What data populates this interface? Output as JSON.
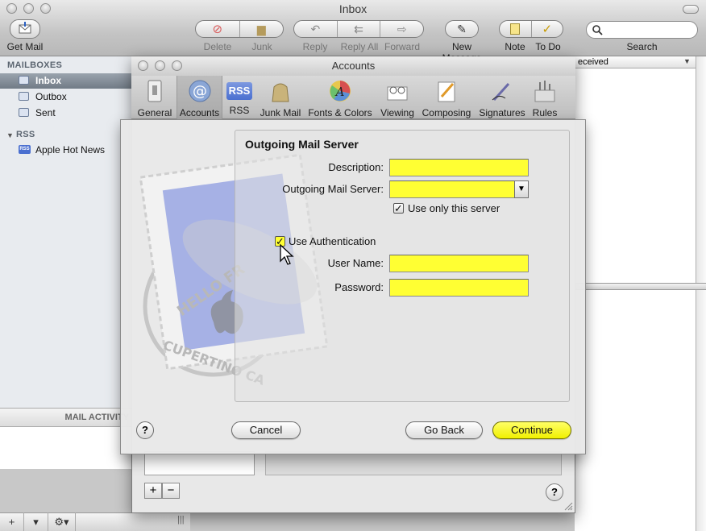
{
  "mail_window": {
    "title": "Inbox",
    "toolbar": {
      "get_mail": "Get Mail",
      "delete": "Delete",
      "junk": "Junk",
      "reply": "Reply",
      "reply_all": "Reply All",
      "forward": "Forward",
      "new_message": "New Message",
      "note": "Note",
      "todo": "To Do",
      "search": "Search"
    },
    "sidebar": {
      "mailboxes_header": "MAILBOXES",
      "items": [
        "Inbox",
        "Outbox",
        "Sent"
      ],
      "rss_header": "RSS",
      "rss_badge": "RSS",
      "rss_items": [
        "Apple Hot News"
      ],
      "mail_activity": "MAIL ACTIVITY"
    },
    "list": {
      "column_header": "eceived"
    },
    "bottom_bar": {
      "add": "+",
      "menu": "▾",
      "action": "⚙▾",
      "split": "|||"
    }
  },
  "prefs_window": {
    "title": "Accounts",
    "toolbar_items": [
      "General",
      "Accounts",
      "RSS",
      "Junk Mail",
      "Fonts & Colors",
      "Viewing",
      "Composing",
      "Signatures",
      "Rules"
    ],
    "rss_icon_text": "RSS",
    "add_label": "+",
    "remove_label": "−",
    "help_label": "?"
  },
  "sheet": {
    "heading": "Outgoing Mail Server",
    "description_label": "Description:",
    "description_value": "",
    "server_label": "Outgoing Mail Server:",
    "server_value": "",
    "use_only_label": "Use only this server",
    "use_only_checked": true,
    "use_auth_label": "Use Authentication",
    "use_auth_checked": true,
    "username_label": "User Name:",
    "username_value": "",
    "password_label": "Password:",
    "password_value": "",
    "check_mark": "✓",
    "help_label": "?",
    "cancel": "Cancel",
    "go_back": "Go Back",
    "continue": "Continue"
  },
  "colors": {
    "highlight_yellow": "#ffff33",
    "sidebar_bg": "#e8ebef",
    "selected_row": "#7d8690"
  }
}
